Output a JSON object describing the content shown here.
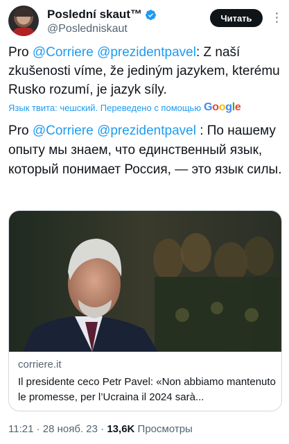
{
  "author": {
    "display_name": "Poslední skaut™",
    "handle": "@Posledniskaut",
    "verified": true
  },
  "follow_button_label": "Читать",
  "tweet": {
    "prefix": "Pro ",
    "mention1": "@Corriere",
    "mention2": "@prezidentpavel",
    "body": ": Z naší zkušenosti víme, že jediným jazykem, kterému Rusko rozumí, je jazyk síly."
  },
  "translation": {
    "note": "Язык твита: чешский. Переведено с помощью",
    "prefix": "Pro ",
    "mention1": "@Corriere",
    "mention2": "@prezidentpavel",
    "body": " : По нашему опыту мы знаем, что единственный язык, который понимает Россия, — это язык силы."
  },
  "link_card": {
    "domain": "corriere.it",
    "title": "Il presidente ceco Petr Pavel: «Non abbiamo mantenuto le promesse, per l’Ucraina il 2024 sarà..."
  },
  "meta": {
    "time": "11:21",
    "date": "28 нояб. 23",
    "views_count": "13,6K",
    "views_label": "Просмотры"
  },
  "colors": {
    "accent": "#1d9bf0",
    "text": "#0f1419",
    "secondary": "#536471",
    "border": "#cfd9de"
  }
}
